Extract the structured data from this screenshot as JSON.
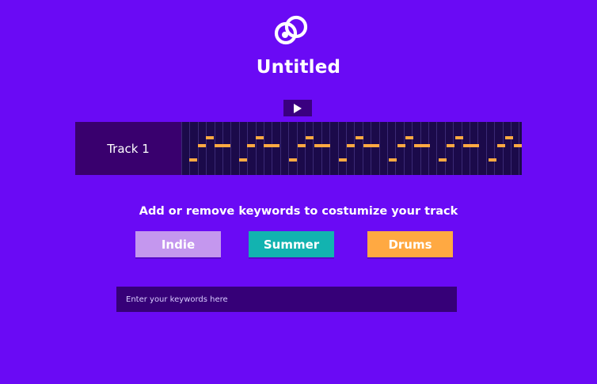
{
  "app": {
    "logo_icon": "app-logo-icon",
    "title": "Untitled"
  },
  "player": {
    "play_icon": "play-icon"
  },
  "tracks": [
    {
      "label": "Track 1"
    }
  ],
  "keywords": {
    "hint": "Add or remove keywords to costumize your track",
    "tags": [
      {
        "label": "Indie",
        "color": "#c497ee"
      },
      {
        "label": "Summer",
        "color": "#12b3b0"
      },
      {
        "label": "Drums",
        "color": "#ffa942"
      }
    ],
    "input_placeholder": "Enter your keywords here"
  },
  "colors": {
    "background": "#6a0af5",
    "track_bg": "#1b0a4a",
    "note": "#ffa942"
  }
}
